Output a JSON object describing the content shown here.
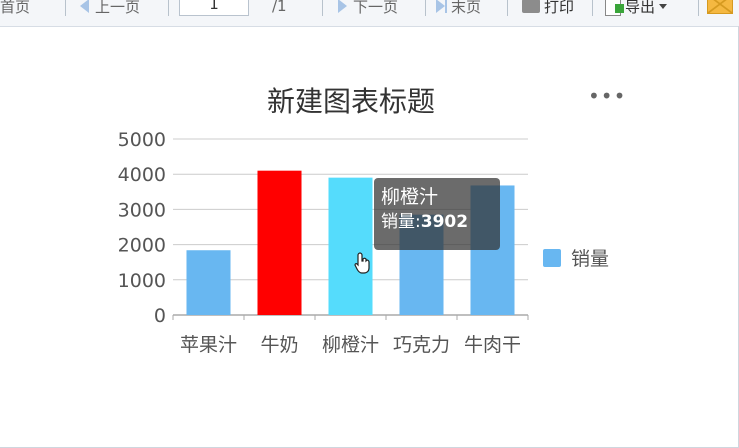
{
  "toolbar": {
    "first_page": "首页",
    "prev_page": "上一页",
    "page_value": "1",
    "page_total": "/1",
    "next_page": "下一页",
    "last_page": "末页",
    "print": "打印",
    "export": "导出"
  },
  "icons": {
    "first": "arrow-first-icon",
    "prev": "arrow-left-icon",
    "next": "arrow-right-icon",
    "last": "arrow-last-icon",
    "print": "printer-icon",
    "export": "export-icon",
    "mail": "mail-icon",
    "more": "more-icon"
  },
  "chart_data": {
    "type": "bar",
    "title": "新建图表标题",
    "categories": [
      "苹果汁",
      "牛奶",
      "柳橙汁",
      "巧克力",
      "牛肉干"
    ],
    "series": [
      {
        "name": "销量",
        "values": [
          1840,
          4100,
          3902,
          2850,
          3680
        ],
        "colors": [
          "#68b7f1",
          "#ff0000",
          "#55dcfc",
          "#68b7f1",
          "#68b7f1"
        ]
      }
    ],
    "ylim": [
      0,
      5000
    ],
    "yticks": [
      "0",
      "1000",
      "2000",
      "3000",
      "4000",
      "5000"
    ],
    "grid": true,
    "legend": "right"
  },
  "tooltip": {
    "title": "柳橙汁",
    "label": "销量:",
    "value": "3902"
  },
  "colors": {
    "bar_default": "#68b7f1",
    "bar_highlight": "#ff0000",
    "bar_hover": "#55dcfc",
    "grid": "#cccccc"
  }
}
